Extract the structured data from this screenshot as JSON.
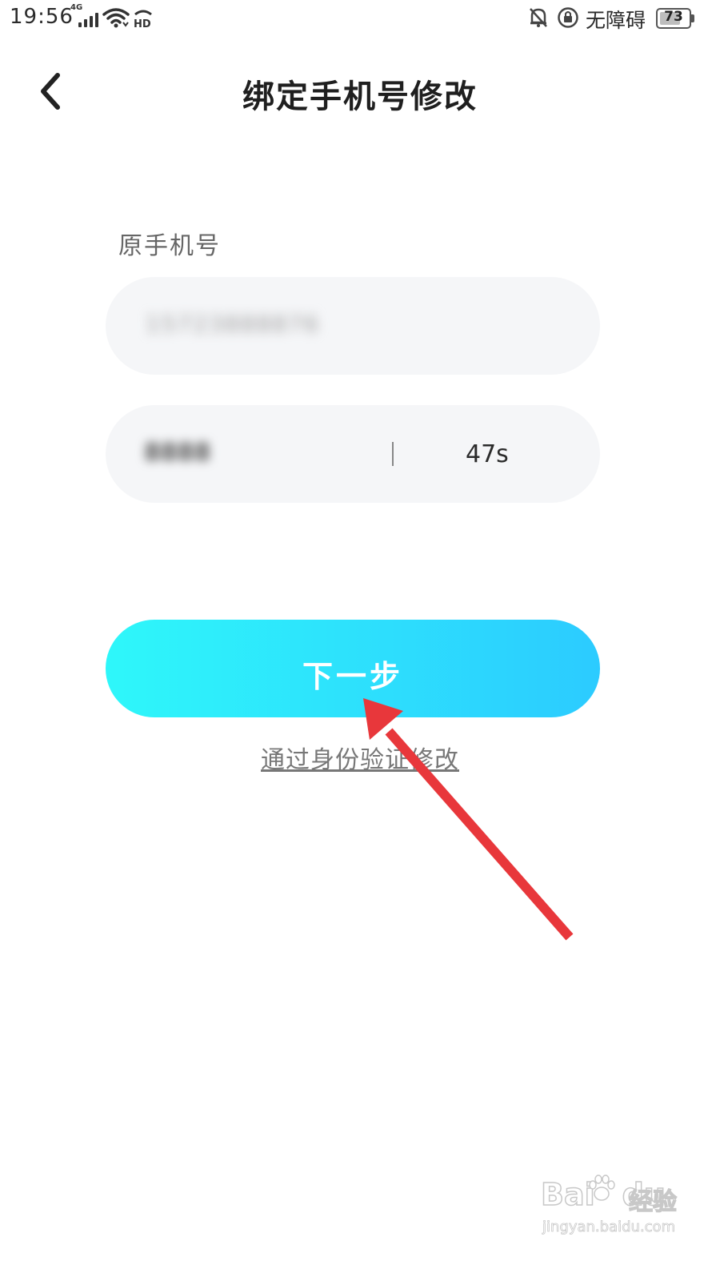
{
  "status_bar": {
    "time": "19:56",
    "network_type": "4G",
    "signal_icon": "signal-bars-icon",
    "wifi_icon": "wifi-icon",
    "hd_icon": "hd-icon",
    "mute_icon": "bell-off-icon",
    "rotation_lock_icon": "lock-icon",
    "accessibility_text": "无障碍",
    "battery_level": "73",
    "battery_fraction": 0.73
  },
  "header": {
    "back_icon": "chevron-left-icon",
    "title": "绑定手机号修改"
  },
  "form": {
    "original_phone_label": "原手机号",
    "original_phone_value": "15723888876",
    "code_value": "8888",
    "countdown": "47s"
  },
  "actions": {
    "next_label": "下一步",
    "alt_link_label": "通过身份验证修改"
  },
  "annotation": {
    "arrow_color": "#e8373b",
    "arrow_icon": "arrow-up-left-icon"
  },
  "watermark": {
    "brand": "Bai",
    "brand_suffix": "du",
    "jingyan": "经验",
    "url": "jingyan.baidu.com"
  },
  "colors": {
    "button_gradient_start": "#2ef7fa",
    "button_gradient_end": "#2ccbff",
    "field_bg": "#f5f6f8"
  }
}
